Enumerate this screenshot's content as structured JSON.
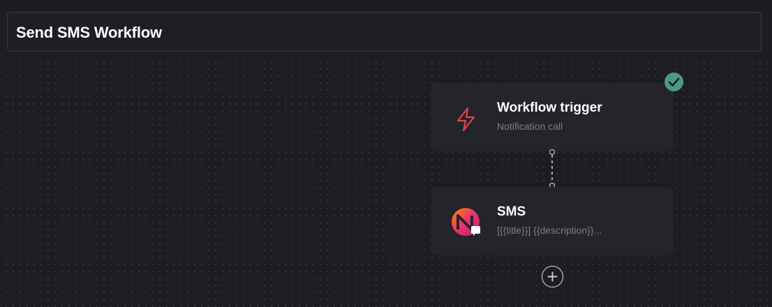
{
  "workflow": {
    "title": "Send SMS Workflow"
  },
  "nodes": [
    {
      "title": "Workflow trigger",
      "subtitle": "Notification call",
      "icon": "lightning-bolt-icon",
      "status": "success"
    },
    {
      "title": "SMS",
      "subtitle": "[{{title}}] {{description}}...",
      "icon": "sms-provider-logo-icon"
    }
  ],
  "colors": {
    "canvas_bg": "#1c1c21",
    "node_bg": "#24242b",
    "success": "#4d9980",
    "trigger_icon": "#e54545"
  }
}
